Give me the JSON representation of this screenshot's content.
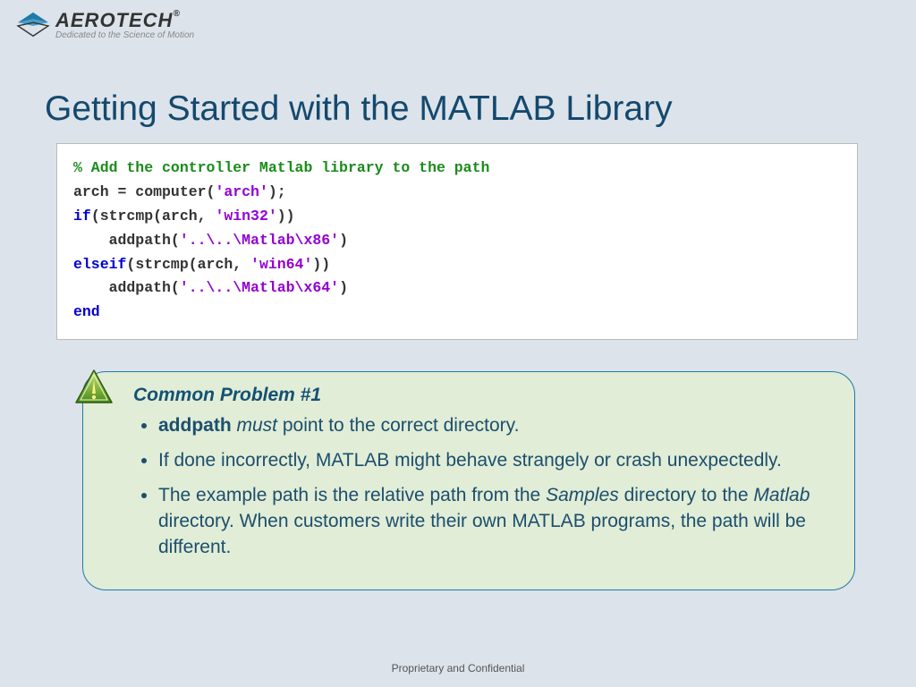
{
  "brand": {
    "name": "AEROTECH",
    "reg": "®",
    "tagline": "Dedicated to the Science of Motion"
  },
  "title": "Getting Started with the MATLAB Library",
  "code": {
    "l1_comment": "% Add the controller Matlab library to the path",
    "l2_a": "arch = computer(",
    "l2_str": "'arch'",
    "l2_b": ");",
    "l3_kw": "if",
    "l3_a": "(strcmp(arch, ",
    "l3_str": "'win32'",
    "l3_b": "))",
    "l4_a": "    addpath(",
    "l4_str": "'..\\..\\Matlab\\x86'",
    "l4_b": ")",
    "l5_kw": "elseif",
    "l5_a": "(strcmp(arch, ",
    "l5_str": "'win64'",
    "l5_b": "))",
    "l6_a": "    addpath(",
    "l6_str": "'..\\..\\Matlab\\x64'",
    "l6_b": ")",
    "l7_kw": "end"
  },
  "callout": {
    "title": "Common Problem #1",
    "b1_bold": "addpath",
    "b1_ital": " must",
    "b1_rest": " point to the correct directory.",
    "b2": "If done incorrectly, MATLAB might behave strangely or crash unexpectedly.",
    "b3_a": "The example path is the relative path from the ",
    "b3_i1": "Samples",
    "b3_b": " directory to the ",
    "b3_i2": "Matlab",
    "b3_c": " directory. When customers write their own MATLAB programs, the path will be different."
  },
  "footer": "Proprietary and Confidential"
}
